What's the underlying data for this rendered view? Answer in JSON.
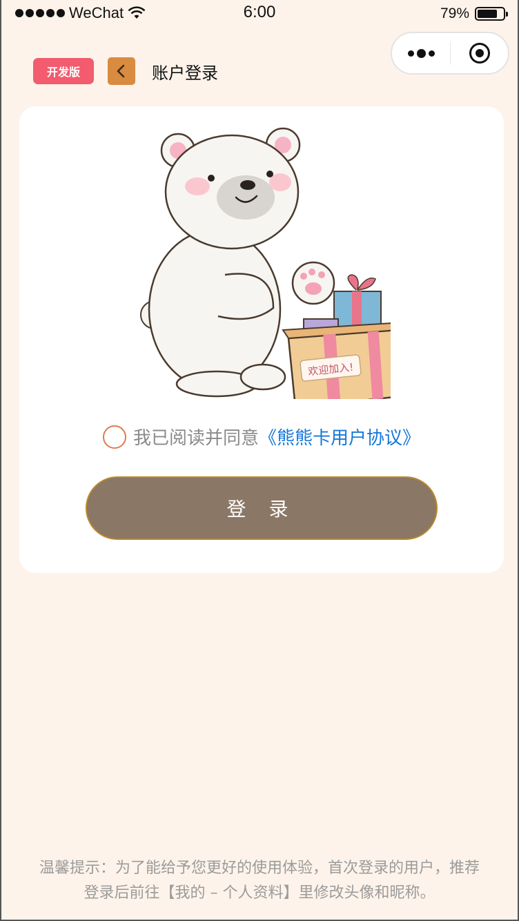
{
  "status_bar": {
    "carrier": "WeChat",
    "time": "6:00",
    "battery": "79%",
    "battery_level": 0.79
  },
  "nav": {
    "dev_badge": "开发版",
    "title": "账户登录"
  },
  "agreement": {
    "prefix": "我已阅读并同意",
    "link": "《熊熊卡用户协议》",
    "checked": false
  },
  "login_button": "登 录",
  "illustration": {
    "box_label": "欢迎加入!"
  },
  "tip": {
    "line1": "温馨提示：为了能给予您更好的使用体验，首次登录的用户，推荐",
    "line2": "登录后前往【我的 – 个人资料】里修改头像和昵称。"
  },
  "colors": {
    "background": "#fdf3ea",
    "badge": "#f25c6e",
    "back_button": "#d98b3f",
    "login_button": "#8b7766",
    "link": "#1677d9"
  }
}
